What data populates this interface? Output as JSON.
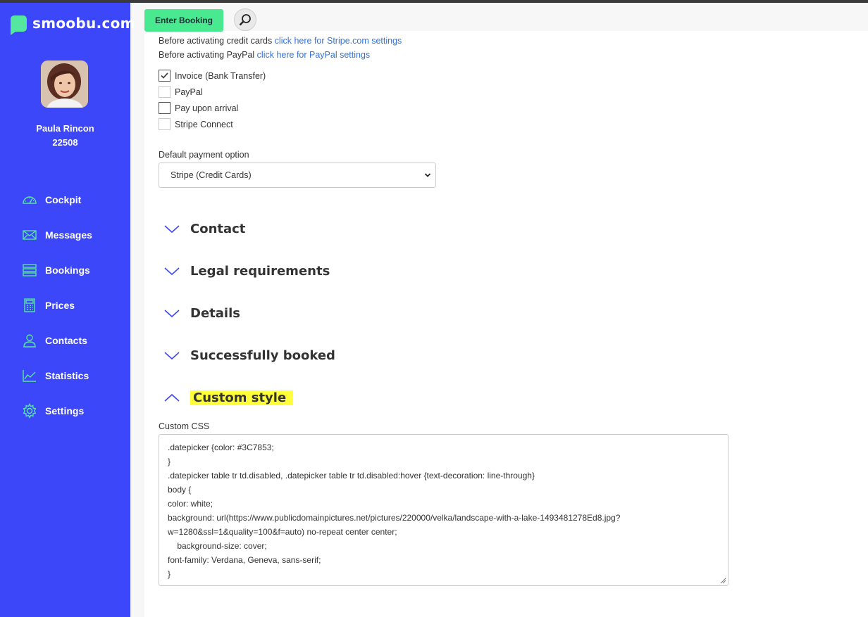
{
  "sidebar": {
    "logo_text": "smoobu.com",
    "user_name": "Paula Rincon",
    "user_id": "22508",
    "items": [
      {
        "label": "Cockpit",
        "icon": "speedometer-icon"
      },
      {
        "label": "Messages",
        "icon": "envelope-icon"
      },
      {
        "label": "Bookings",
        "icon": "list-icon"
      },
      {
        "label": "Prices",
        "icon": "calculator-icon"
      },
      {
        "label": "Contacts",
        "icon": "people-icon"
      },
      {
        "label": "Statistics",
        "icon": "chart-icon"
      },
      {
        "label": "Settings",
        "icon": "gear-icon"
      }
    ]
  },
  "topbar": {
    "enter_booking_label": "Enter Booking",
    "search_icon": "search-icon"
  },
  "payment": {
    "stripe_prefix": "Before activating credit cards ",
    "stripe_link": "click here for Stripe.com settings",
    "paypal_prefix": "Before activating PayPal ",
    "paypal_link": "click here for PayPal settings",
    "options": [
      {
        "label": "Invoice (Bank Transfer)",
        "checked": true
      },
      {
        "label": "PayPal",
        "checked": false
      },
      {
        "label": "Pay upon arrival",
        "checked": false
      },
      {
        "label": "Stripe Connect",
        "checked": false
      }
    ],
    "default_label": "Default payment option",
    "default_value": "Stripe (Credit Cards)"
  },
  "sections": [
    {
      "title": "Contact",
      "expanded": false
    },
    {
      "title": "Legal requirements",
      "expanded": false
    },
    {
      "title": "Details",
      "expanded": false
    },
    {
      "title": "Successfully booked",
      "expanded": false
    },
    {
      "title": "Custom style",
      "expanded": true
    }
  ],
  "custom_css": {
    "label": "Custom CSS",
    "lines": [
      ".datepicker {color: #3C7853;",
      "}",
      ".datepicker table tr td.disabled, .datepicker table tr td.disabled:hover {text-decoration: line-through}",
      "body {",
      "color: white;",
      "background: url(https://www.publicdomainpictures.net/pictures/220000/velka/landscape-with-a-lake-1493481278Ed8.jpg?",
      "w=1280&ssl=1&quality=100&f=auto) no-repeat center center;",
      "    background-size: cover;",
      "font-family: Verdana, Geneva, sans-serif;",
      "}"
    ]
  },
  "colors": {
    "sidebar": "#3c47fa",
    "accent_green": "#49e98f",
    "link": "#3273dc",
    "highlight": "#ffff3a"
  }
}
